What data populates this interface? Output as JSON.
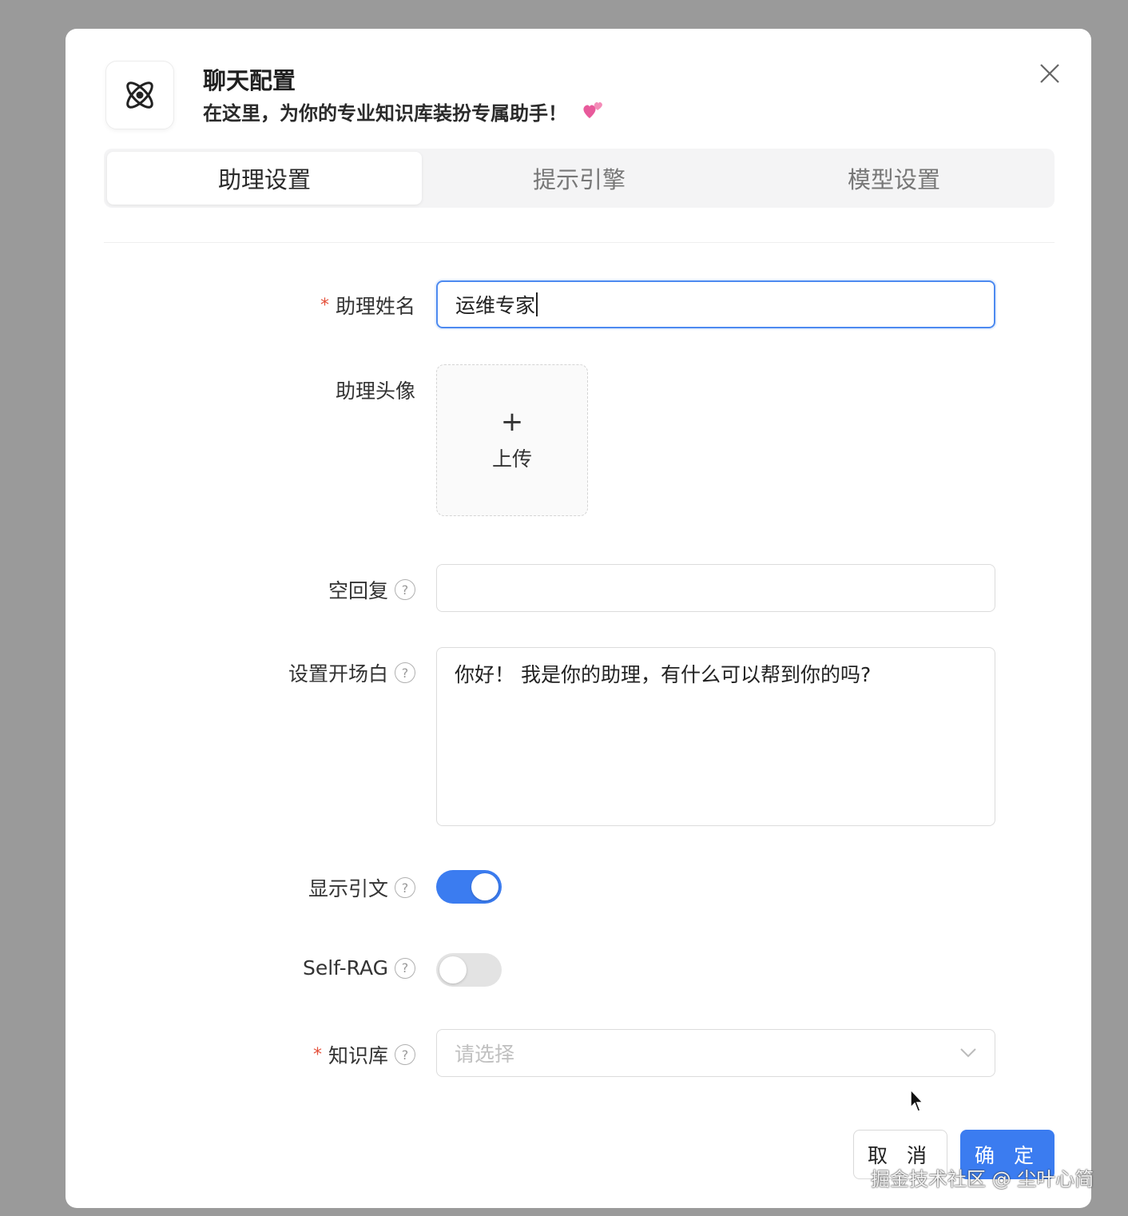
{
  "dialog": {
    "title": "聊天配置",
    "subtitle": "在这里，为你的专业知识库装扮专属助手！",
    "header_icon": "atom-icon",
    "subtitle_emoji": "hearts-icon"
  },
  "tabs": [
    {
      "label": "助理设置",
      "active": true
    },
    {
      "label": "提示引擎",
      "active": false
    },
    {
      "label": "模型设置",
      "active": false
    }
  ],
  "form": {
    "assistant_name": {
      "label": "助理姓名",
      "required": "*",
      "value": "运维专家"
    },
    "avatar": {
      "label": "助理头像",
      "upload_icon": "+",
      "upload_label": "上传"
    },
    "empty_reply": {
      "label": "空回复",
      "value": ""
    },
    "opening": {
      "label": "设置开场白",
      "value": "你好！ 我是你的助理，有什么可以帮到你的吗?"
    },
    "show_citation": {
      "label": "显示引文",
      "enabled": true
    },
    "self_rag": {
      "label": "Self-RAG",
      "enabled": false
    },
    "knowledge_base": {
      "label": "知识库",
      "required": "*",
      "placeholder": "请选择"
    }
  },
  "help_glyph": "?",
  "buttons": {
    "cancel": "取 消",
    "ok": "确 定"
  },
  "watermark": "掘金技术社区 @ 尘叶心简",
  "colors": {
    "primary": "#3b7cf0",
    "required": "#e4503a",
    "switch_off": "#e3e3e3"
  }
}
